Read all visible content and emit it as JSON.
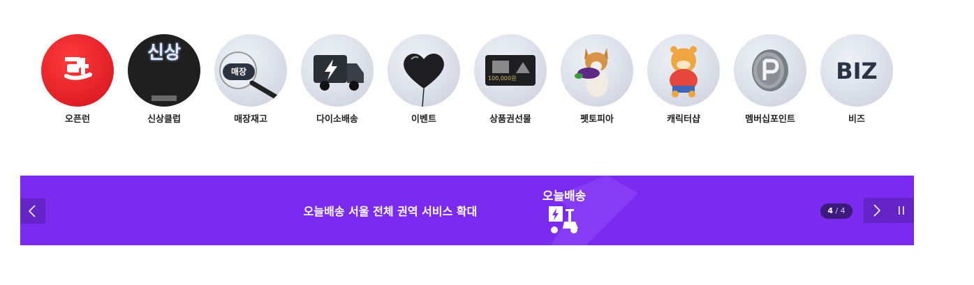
{
  "categories": [
    {
      "label": "오픈런",
      "icon": "open-run-icon"
    },
    {
      "label": "신상클럽",
      "icon": "new-arrivals-club-icon",
      "image_text": "신상"
    },
    {
      "label": "매장재고",
      "icon": "magnifier-store-stock-icon",
      "image_text": "매장"
    },
    {
      "label": "다이소배송",
      "icon": "delivery-truck-icon"
    },
    {
      "label": "이벤트",
      "icon": "heart-balloon-icon"
    },
    {
      "label": "상품권선물",
      "icon": "gift-card-icon",
      "image_text": "100,000원"
    },
    {
      "label": "펫토피아",
      "icon": "corgi-dog-icon"
    },
    {
      "label": "캐릭터샵",
      "icon": "tiger-plush-icon"
    },
    {
      "label": "멤버십포인트",
      "icon": "point-coin-icon"
    },
    {
      "label": "비즈",
      "icon": "biz-text-icon",
      "image_text": "BIZ"
    }
  ],
  "banner": {
    "headline": "오늘배송 서울 전체 권역 서비스 확대",
    "brand_text": "오늘배송",
    "pager_current": "4",
    "pager_sep": " / ",
    "pager_total": "4",
    "background_color": "#7b2bf0",
    "accent_color": "#ed1c24"
  }
}
